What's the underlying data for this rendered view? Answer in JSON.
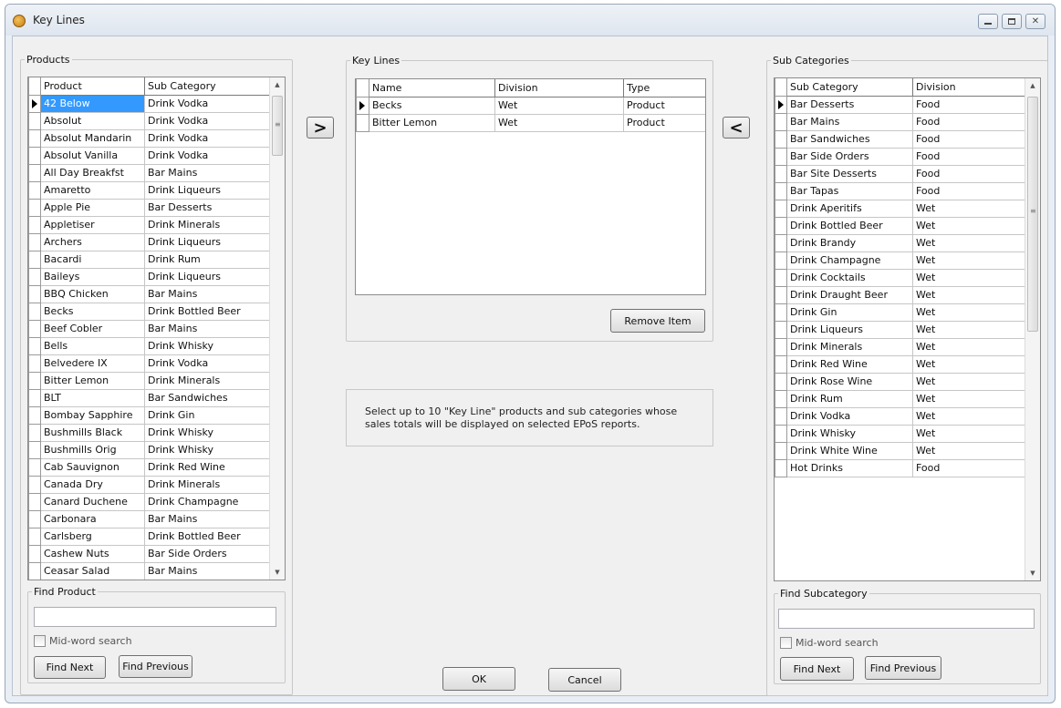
{
  "window": {
    "title": "Key Lines"
  },
  "products": {
    "group_label": "Products",
    "columns": [
      "Product",
      "Sub Category"
    ],
    "rows": [
      [
        "42 Below",
        "Drink Vodka"
      ],
      [
        "Absolut",
        "Drink Vodka"
      ],
      [
        "Absolut Mandarin",
        "Drink Vodka"
      ],
      [
        "Absolut Vanilla",
        "Drink Vodka"
      ],
      [
        "All Day Breakfst",
        "Bar Mains"
      ],
      [
        "Amaretto",
        "Drink Liqueurs"
      ],
      [
        "Apple Pie",
        "Bar Desserts"
      ],
      [
        "Appletiser",
        "Drink Minerals"
      ],
      [
        "Archers",
        "Drink Liqueurs"
      ],
      [
        "Bacardi",
        "Drink Rum"
      ],
      [
        "Baileys",
        "Drink Liqueurs"
      ],
      [
        "BBQ Chicken",
        "Bar Mains"
      ],
      [
        "Becks",
        "Drink Bottled Beer"
      ],
      [
        "Beef Cobler",
        "Bar Mains"
      ],
      [
        "Bells",
        "Drink Whisky"
      ],
      [
        "Belvedere IX",
        "Drink Vodka"
      ],
      [
        "Bitter Lemon",
        "Drink Minerals"
      ],
      [
        "BLT",
        "Bar Sandwiches"
      ],
      [
        "Bombay Sapphire",
        "Drink Gin"
      ],
      [
        "Bushmills Black",
        "Drink Whisky"
      ],
      [
        "Bushmills Orig",
        "Drink Whisky"
      ],
      [
        "Cab Sauvignon",
        "Drink Red Wine"
      ],
      [
        "Canada Dry",
        "Drink Minerals"
      ],
      [
        "Canard Duchene",
        "Drink Champagne"
      ],
      [
        "Carbonara",
        "Bar Mains"
      ],
      [
        "Carlsberg",
        "Drink Bottled Beer"
      ],
      [
        "Cashew Nuts",
        "Bar Side Orders"
      ],
      [
        "Ceasar Salad",
        "Bar Mains"
      ]
    ],
    "find_label": "Find Product",
    "find_value": "",
    "midword_label": "Mid-word search",
    "find_next": "Find Next",
    "find_previous": "Find Previous"
  },
  "keylines": {
    "group_label": "Key Lines",
    "columns": [
      "Name",
      "Division",
      "Type"
    ],
    "rows": [
      [
        "Becks",
        "Wet",
        "Product"
      ],
      [
        "Bitter Lemon",
        "Wet",
        "Product"
      ]
    ],
    "remove_label": "Remove Item"
  },
  "add_button": ">",
  "remove_button": "<",
  "info": "Select up to 10 \"Key Line\" products and sub categories whose sales totals will be displayed on selected EPoS reports.",
  "subcats": {
    "group_label": "Sub Categories",
    "columns": [
      "Sub Category",
      "Division"
    ],
    "rows": [
      [
        "Bar Desserts",
        "Food"
      ],
      [
        "Bar Mains",
        "Food"
      ],
      [
        "Bar Sandwiches",
        "Food"
      ],
      [
        "Bar Side Orders",
        "Food"
      ],
      [
        "Bar Site Desserts",
        "Food"
      ],
      [
        "Bar Tapas",
        "Food"
      ],
      [
        "Drink Aperitifs",
        "Wet"
      ],
      [
        "Drink Bottled Beer",
        "Wet"
      ],
      [
        "Drink Brandy",
        "Wet"
      ],
      [
        "Drink Champagne",
        "Wet"
      ],
      [
        "Drink Cocktails",
        "Wet"
      ],
      [
        "Drink Draught Beer",
        "Wet"
      ],
      [
        "Drink Gin",
        "Wet"
      ],
      [
        "Drink Liqueurs",
        "Wet"
      ],
      [
        "Drink Minerals",
        "Wet"
      ],
      [
        "Drink Red Wine",
        "Wet"
      ],
      [
        "Drink Rose Wine",
        "Wet"
      ],
      [
        "Drink Rum",
        "Wet"
      ],
      [
        "Drink Vodka",
        "Wet"
      ],
      [
        "Drink Whisky",
        "Wet"
      ],
      [
        "Drink White Wine",
        "Wet"
      ],
      [
        "Hot Drinks",
        "Food"
      ]
    ],
    "find_label": "Find Subcategory",
    "find_value": "",
    "midword_label": "Mid-word search",
    "find_next": "Find Next",
    "find_previous": "Find Previous"
  },
  "ok": "OK",
  "cancel": "Cancel",
  "icons": {
    "app": "key-lines-app-icon",
    "minimize": "minimize-icon",
    "maximize": "maximize-icon",
    "close": "close-icon",
    "row_indicator": "current-row-arrow-icon"
  },
  "colors": {
    "selection": "#3399ff"
  }
}
